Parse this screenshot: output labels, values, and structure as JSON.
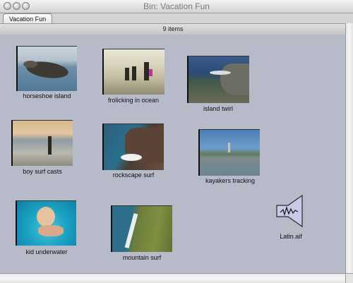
{
  "window": {
    "title": "Bin: Vacation Fun"
  },
  "tab": {
    "label": "Vacation Fun"
  },
  "status": {
    "count": "9 items"
  },
  "clips": [
    {
      "label": "horseshoe island"
    },
    {
      "label": "frolicking in ocean"
    },
    {
      "label": "island twirl"
    },
    {
      "label": "boy surf casts"
    },
    {
      "label": "rockscape surf"
    },
    {
      "label": "kayakers tracking"
    },
    {
      "label": "kid underwater"
    },
    {
      "label": "mountain surf"
    }
  ],
  "audio": {
    "label": "Latin.aif",
    "icon": "speaker-waveform-icon"
  }
}
